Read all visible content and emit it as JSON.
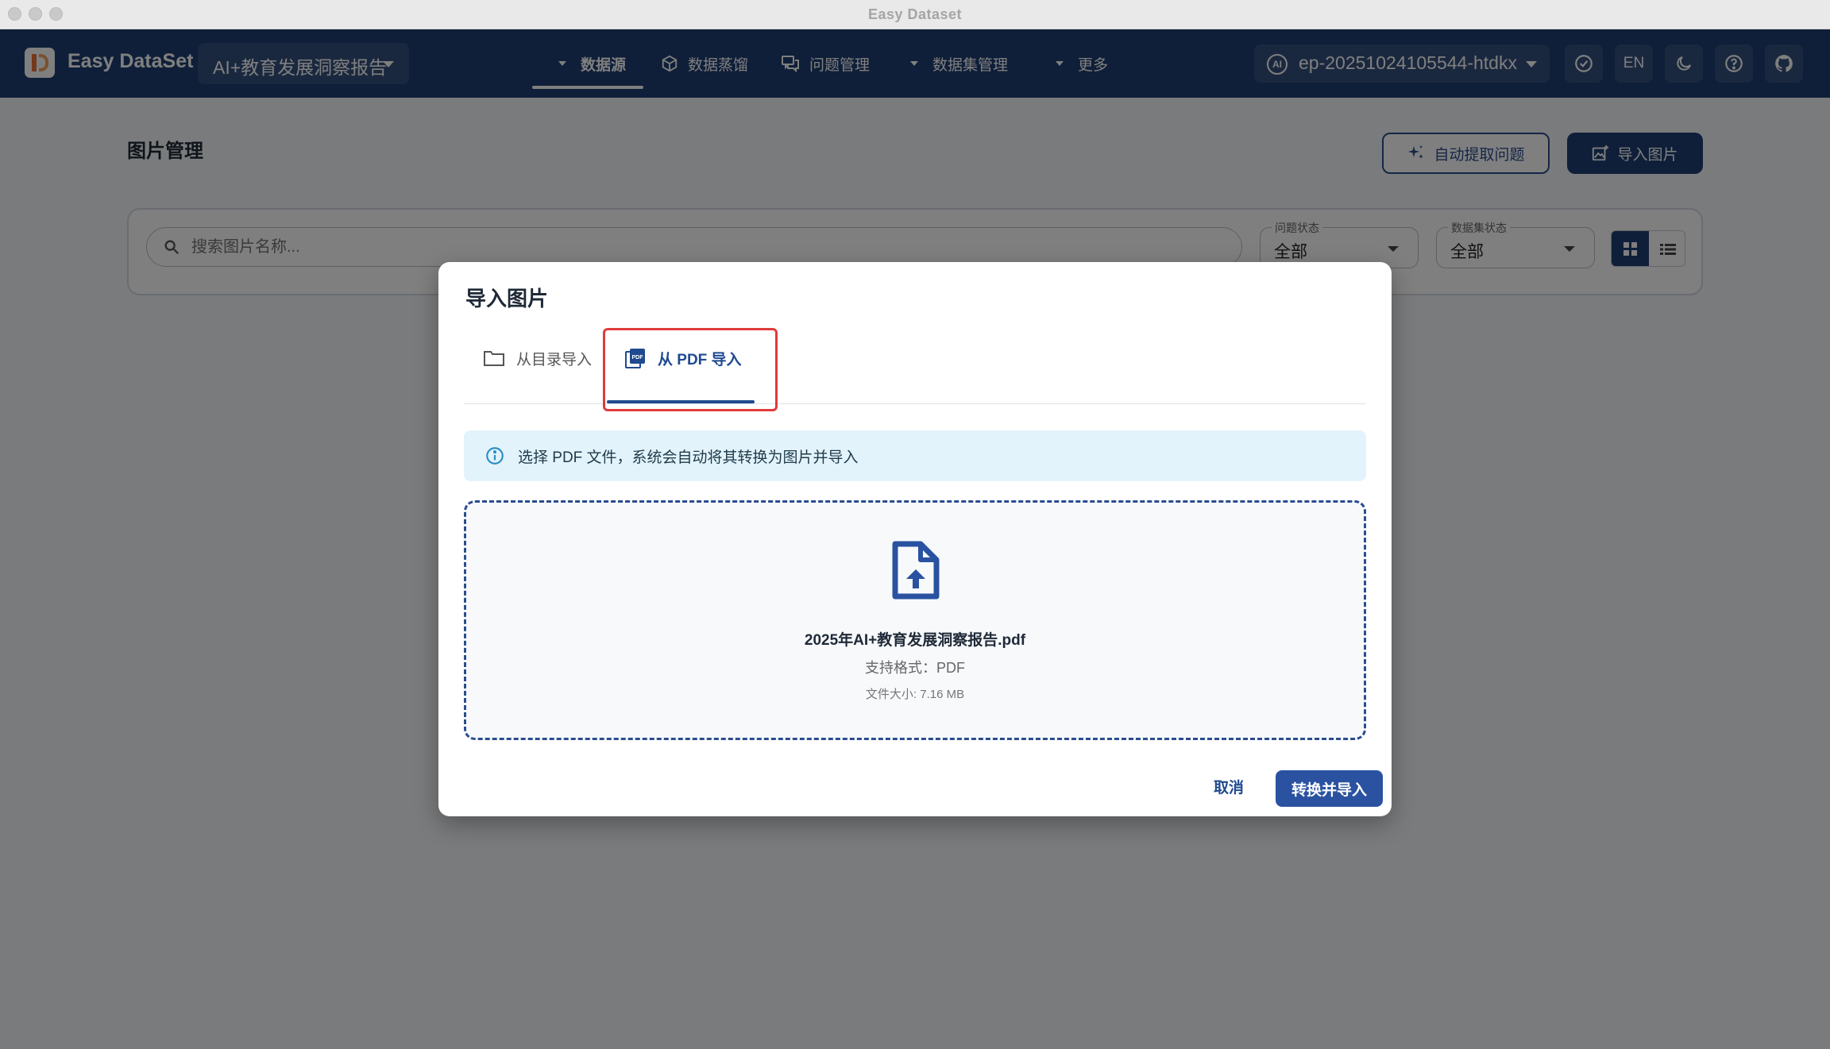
{
  "window": {
    "title": "Easy Dataset"
  },
  "header": {
    "app_name": "Easy DataSet",
    "project_name": "AI+教育发展洞察报告",
    "nav": [
      {
        "label": "数据源",
        "active": true,
        "icon": "caret-down-icon"
      },
      {
        "label": "数据蒸馏",
        "active": false,
        "icon": "cube-icon"
      },
      {
        "label": "问题管理",
        "active": false,
        "icon": "chat-icon"
      },
      {
        "label": "数据集管理",
        "active": false,
        "icon": "caret-down-icon"
      },
      {
        "label": "更多",
        "active": false,
        "icon": "caret-down-icon"
      }
    ],
    "model_name": "ep-20251024105544-htdkx",
    "lang_label": "EN"
  },
  "page": {
    "title": "图片管理",
    "auto_extract_label": "自动提取问题",
    "import_images_label": "导入图片",
    "search_placeholder": "搜索图片名称...",
    "question_status_label": "问题状态",
    "question_status_value": "全部",
    "dataset_status_label": "数据集状态",
    "dataset_status_value": "全部"
  },
  "dialog": {
    "title": "导入图片",
    "tabs": [
      {
        "label": "从目录导入",
        "active": false,
        "icon": "folder-icon"
      },
      {
        "label": "从 PDF 导入",
        "active": true,
        "icon": "pdf-icon"
      }
    ],
    "info_text": "选择 PDF 文件，系统会自动将其转换为图片并导入",
    "file_name": "2025年AI+教育发展洞察报告.pdf",
    "supported_format": "支持格式：PDF",
    "file_size": "文件大小: 7.16 MB",
    "cancel_label": "取消",
    "confirm_label": "转换并导入"
  },
  "colors": {
    "header_bg": "#1f3e72",
    "accent": "#2a52a0",
    "highlight": "#e03b3b",
    "info_bg": "#e3f3fb"
  }
}
